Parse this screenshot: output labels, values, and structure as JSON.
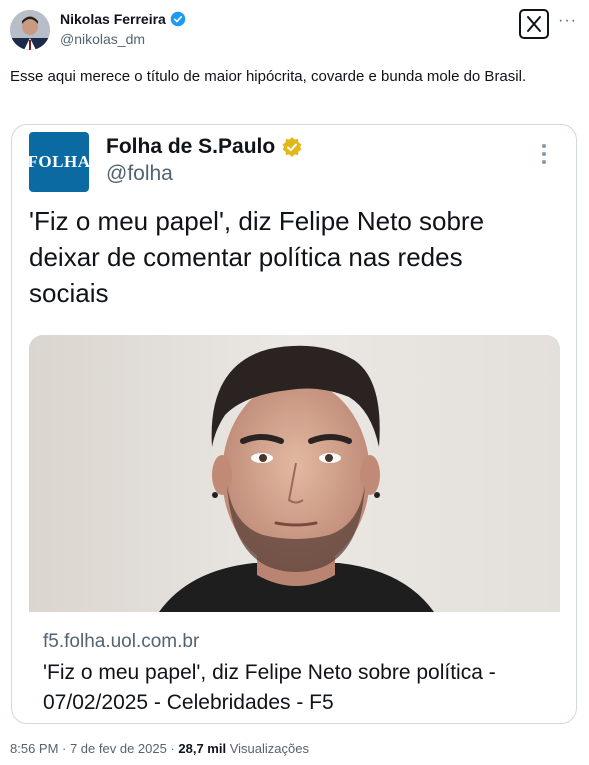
{
  "author": {
    "name": "Nikolas Ferreira",
    "handle": "@nikolas_dm",
    "verified_color": "#1d9bf0"
  },
  "header": {
    "app_icon": "x-logo-icon",
    "more_label": "···"
  },
  "tweet": {
    "text": "Esse aqui merece o título de maior hipócrita, covarde e bunda mole do Brasil."
  },
  "quoted": {
    "logo_text": "FOLHA",
    "name": "Folha de S.Paulo",
    "handle": "@folha",
    "verified_color": "#e2b719",
    "text": "'Fiz o meu papel', diz Felipe Neto sobre deixar de comentar política nas redes sociais",
    "link": {
      "domain": "f5.folha.uol.com.br",
      "title": "'Fiz o meu papel', diz Felipe Neto sobre política - 07/02/2025 - Celebridades - F5"
    }
  },
  "footer": {
    "time": "8:56 PM · 7 de fev de 2025 · ",
    "views_count": "28,7 mil",
    "views_label": " Visualizações"
  }
}
